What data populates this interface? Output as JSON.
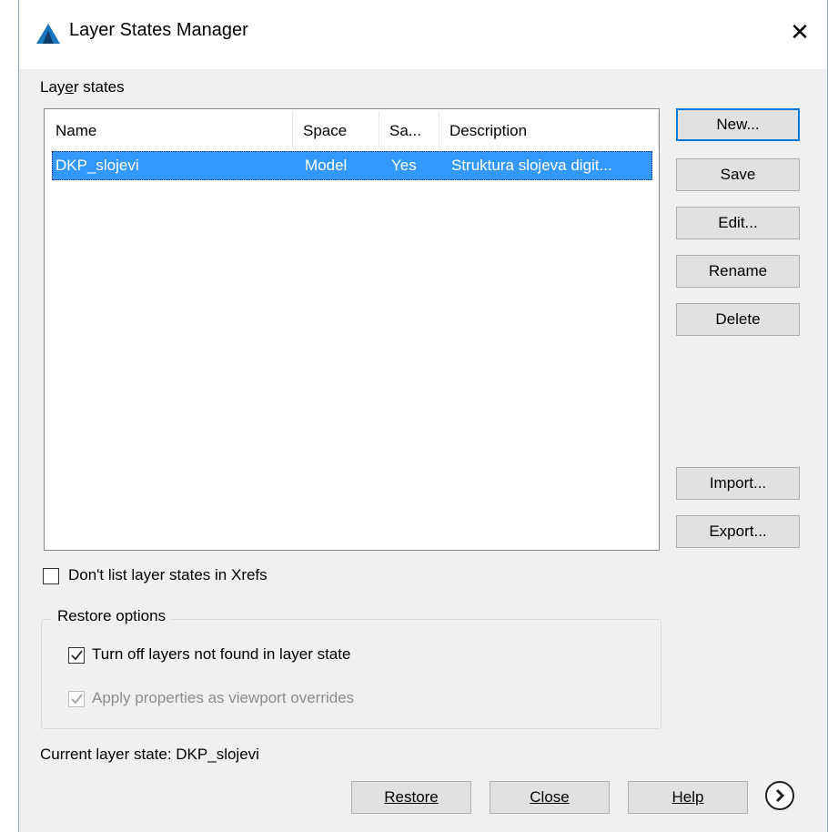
{
  "window": {
    "title": "Layer States Manager",
    "close": "✕"
  },
  "layer_states": {
    "label": "Layer states",
    "columns": [
      "Name",
      "Space",
      "Sa...",
      "Description"
    ],
    "rows": [
      {
        "name": "DKP_slojevi",
        "space": "Model",
        "saved": "Yes",
        "description": "Struktura slojeva digit..."
      }
    ]
  },
  "buttons": {
    "new": "New...",
    "save": "Save",
    "edit": "Edit...",
    "rename": "Rename",
    "delete": "Delete",
    "import": "Import...",
    "export": "Export...",
    "restore": "Restore",
    "close": "Close",
    "help": "Help"
  },
  "options": {
    "dont_list_xrefs": {
      "label": "Don't list layer states in Xrefs",
      "checked": false
    },
    "restore_group": "Restore options",
    "turn_off_layers": {
      "label": "Turn off layers not found in layer state",
      "checked": true
    },
    "apply_viewport": {
      "label": "Apply properties as viewport overrides",
      "checked": true,
      "disabled": true
    }
  },
  "status": {
    "current_layer_state": "Current layer state: DKP_slojevi"
  },
  "colors": {
    "selection": "#3399ff",
    "accent": "#0078d7",
    "icon": "#1b75bb"
  },
  "icons": {
    "app": "autocad-a-icon",
    "more": "chevron-right-circle-icon"
  }
}
